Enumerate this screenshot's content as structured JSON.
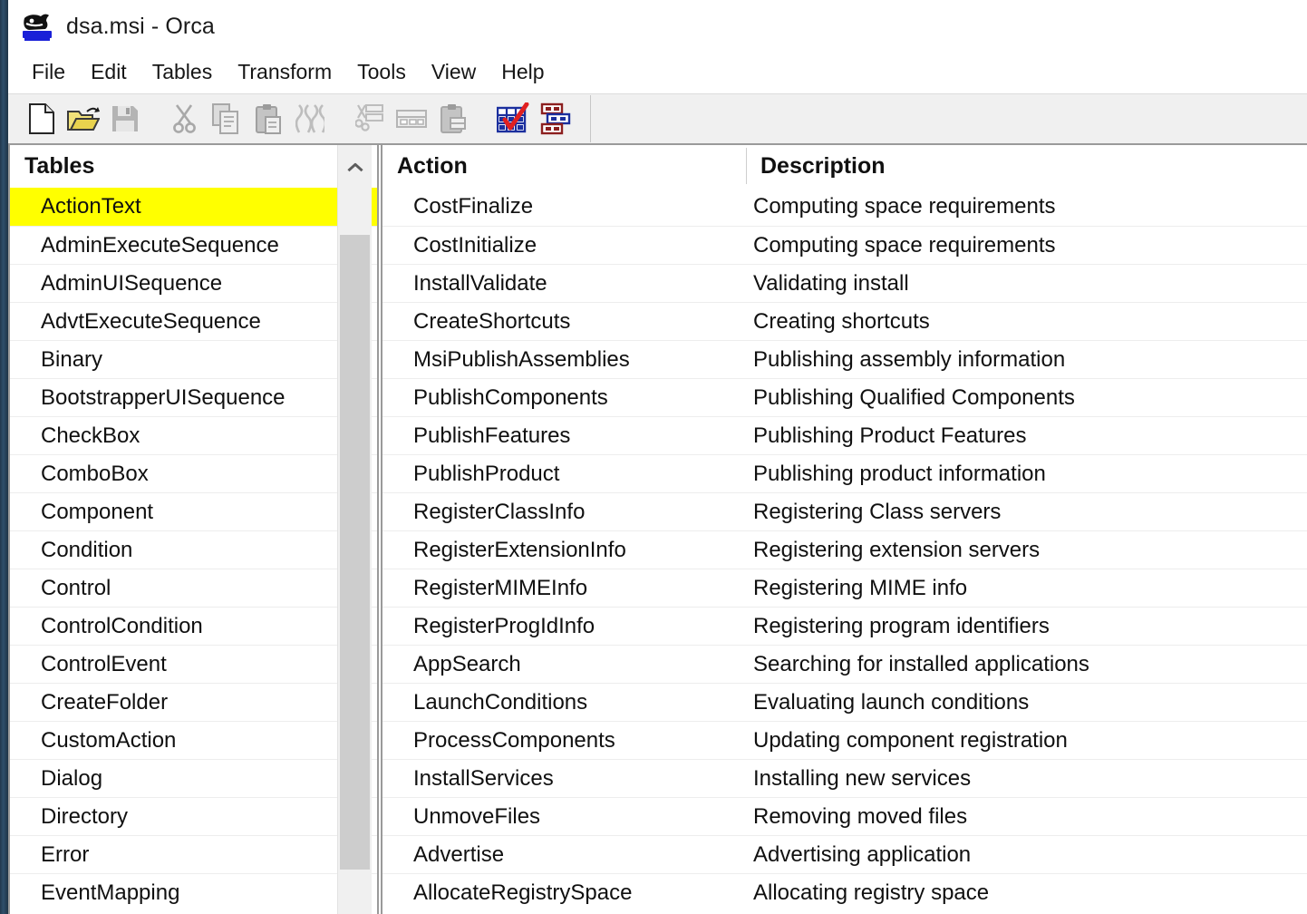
{
  "window": {
    "title": "dsa.msi - Orca",
    "icon": "orca-whale-icon"
  },
  "menubar": {
    "items": [
      {
        "label": "File",
        "name": "menu-file"
      },
      {
        "label": "Edit",
        "name": "menu-edit"
      },
      {
        "label": "Tables",
        "name": "menu-tables"
      },
      {
        "label": "Transform",
        "name": "menu-transform"
      },
      {
        "label": "Tools",
        "name": "menu-tools"
      },
      {
        "label": "View",
        "name": "menu-view"
      },
      {
        "label": "Help",
        "name": "menu-help"
      }
    ]
  },
  "toolbar": {
    "buttons": [
      {
        "icon": "new-file-icon",
        "label": "New",
        "enabled": true
      },
      {
        "icon": "open-folder-icon",
        "label": "Open",
        "enabled": true
      },
      {
        "icon": "save-floppy-icon",
        "label": "Save",
        "enabled": false
      },
      {
        "icon": "cut-scissors-icon",
        "label": "Cut",
        "enabled": false
      },
      {
        "icon": "copy-pages-icon",
        "label": "Copy",
        "enabled": false
      },
      {
        "icon": "paste-clipboard-icon",
        "label": "Paste",
        "enabled": false
      },
      {
        "icon": "drop-row-icon",
        "label": "Drop Row",
        "enabled": false
      },
      {
        "icon": "cut-table-icon",
        "label": "Cut Table",
        "enabled": false
      },
      {
        "icon": "copy-table-icon",
        "label": "Copy Table",
        "enabled": false
      },
      {
        "icon": "paste-table-icon",
        "label": "Paste Table",
        "enabled": false
      },
      {
        "icon": "validate-check-icon",
        "label": "Validate",
        "enabled": true
      },
      {
        "icon": "tables-stack-icon",
        "label": "Add Tables",
        "enabled": true
      }
    ]
  },
  "left_pane": {
    "header": "Tables",
    "selected": "ActionText",
    "items": [
      "ActionText",
      "AdminExecuteSequence",
      "AdminUISequence",
      "AdvtExecuteSequence",
      "Binary",
      "BootstrapperUISequence",
      "CheckBox",
      "ComboBox",
      "Component",
      "Condition",
      "Control",
      "ControlCondition",
      "ControlEvent",
      "CreateFolder",
      "CustomAction",
      "Dialog",
      "Directory",
      "Error",
      "EventMapping"
    ]
  },
  "right_pane": {
    "columns": [
      "Action",
      "Description"
    ],
    "rows": [
      {
        "action": "CostFinalize",
        "description": "Computing space requirements"
      },
      {
        "action": "CostInitialize",
        "description": "Computing space requirements"
      },
      {
        "action": "InstallValidate",
        "description": "Validating install"
      },
      {
        "action": "CreateShortcuts",
        "description": "Creating shortcuts"
      },
      {
        "action": "MsiPublishAssemblies",
        "description": "Publishing assembly information"
      },
      {
        "action": "PublishComponents",
        "description": "Publishing Qualified Components"
      },
      {
        "action": "PublishFeatures",
        "description": "Publishing Product Features"
      },
      {
        "action": "PublishProduct",
        "description": "Publishing product information"
      },
      {
        "action": "RegisterClassInfo",
        "description": "Registering Class servers"
      },
      {
        "action": "RegisterExtensionInfo",
        "description": "Registering extension servers"
      },
      {
        "action": "RegisterMIMEInfo",
        "description": "Registering MIME info"
      },
      {
        "action": "RegisterProgIdInfo",
        "description": "Registering program identifiers"
      },
      {
        "action": "AppSearch",
        "description": "Searching for installed applications"
      },
      {
        "action": "LaunchConditions",
        "description": "Evaluating launch conditions"
      },
      {
        "action": "ProcessComponents",
        "description": "Updating component registration"
      },
      {
        "action": "InstallServices",
        "description": "Installing new services"
      },
      {
        "action": "UnmoveFiles",
        "description": "Removing moved files"
      },
      {
        "action": "Advertise",
        "description": "Advertising application"
      },
      {
        "action": "AllocateRegistrySpace",
        "description": "Allocating registry space"
      }
    ]
  },
  "colors": {
    "selection": "#ffff00",
    "toolbar_bg": "#f0f0f0",
    "grid_line": "#ededed",
    "icon_blue": "#1b2f9e",
    "icon_red": "#8c1f1f",
    "check_red": "#e02020"
  }
}
